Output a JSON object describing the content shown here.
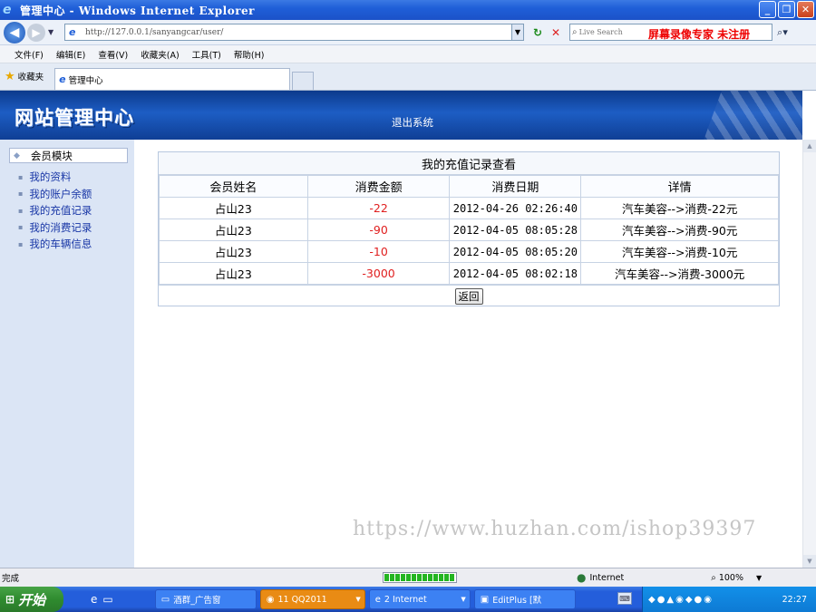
{
  "browser": {
    "title": "管理中心 - Windows Internet Explorer",
    "url": "http://127.0.0.1/sanyangcar/user/",
    "search_placeholder": "Live Search",
    "recorder_watermark": "屏幕录像专家 未注册",
    "menu": [
      "文件(F)",
      "编辑(E)",
      "查看(V)",
      "收藏夹(A)",
      "工具(T)",
      "帮助(H)"
    ],
    "favorites_label": "收藏夹",
    "tab_label": "管理中心"
  },
  "site": {
    "logo": "网站管理中心",
    "logout": "退出系统"
  },
  "sidebar": {
    "section_title": "会员模块",
    "items": [
      {
        "label": "我的资料"
      },
      {
        "label": "我的账户余额"
      },
      {
        "label": "我的充值记录"
      },
      {
        "label": "我的消费记录"
      },
      {
        "label": "我的车辆信息"
      }
    ]
  },
  "records": {
    "title": "我的充值记录查看",
    "columns": [
      "会员姓名",
      "消费金额",
      "消费日期",
      "详情"
    ],
    "rows": [
      {
        "name": "占山23",
        "amount": "-22",
        "date": "2012-04-26 02:26:40",
        "detail": "汽车美容-->消费-22元"
      },
      {
        "name": "占山23",
        "amount": "-90",
        "date": "2012-04-05 08:05:28",
        "detail": "汽车美容-->消费-90元"
      },
      {
        "name": "占山23",
        "amount": "-10",
        "date": "2012-04-05 08:05:20",
        "detail": "汽车美容-->消费-10元"
      },
      {
        "name": "占山23",
        "amount": "-3000",
        "date": "2012-04-05 08:02:18",
        "detail": "汽车美容-->消费-3000元"
      }
    ],
    "back_label": "返回"
  },
  "page_watermark": "https://www.huzhan.com/ishop39397",
  "status": {
    "text": "完成",
    "progress_fraction": 1.0,
    "zone": "Internet",
    "zoom": "100%"
  },
  "taskbar": {
    "start": "开始",
    "tasks": [
      {
        "label": "酒群_广告窗"
      },
      {
        "label": "11 QQ2011"
      },
      {
        "label": "2 Internet"
      },
      {
        "label": "EditPlus [默"
      }
    ],
    "clock": "22:27"
  },
  "colors": {
    "banner": "#1d5dc4",
    "sidebar_bg": "#dbe5f5",
    "amount_red": "#e02020",
    "link_blue": "#1836a6"
  }
}
